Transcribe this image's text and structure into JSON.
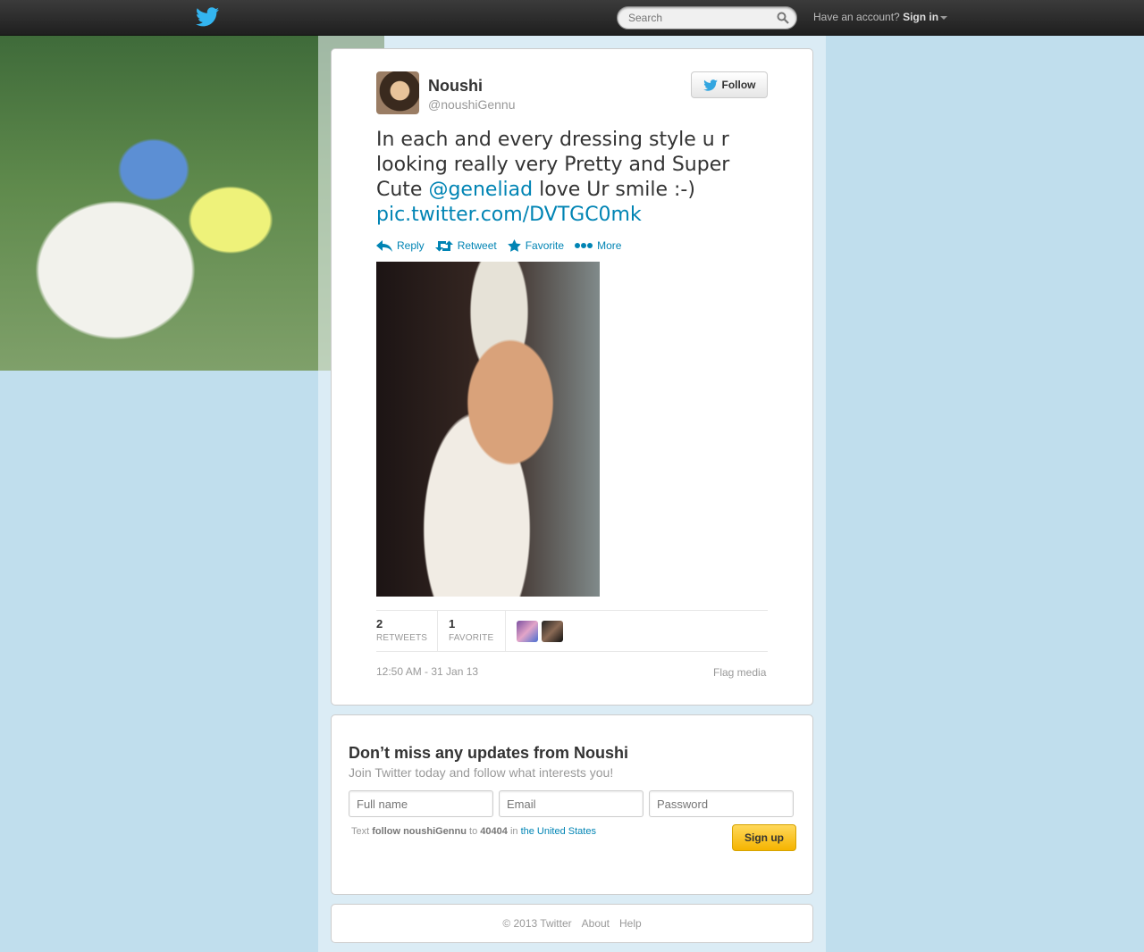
{
  "topbar": {
    "search_placeholder": "Search",
    "have_account": "Have an account?",
    "sign_in": "Sign in"
  },
  "tweet": {
    "name": "Noushi",
    "handle": "@noushiGennu",
    "follow_label": "Follow",
    "text_part1": "In each and every dressing style u r looking really very Pretty and Super Cute ",
    "mention": "@geneliad",
    "text_part2": " love Ur smile :-) ",
    "link": "pic.twitter.com/DVTGC0mk",
    "actions": {
      "reply": "Reply",
      "retweet": "Retweet",
      "favorite": "Favorite",
      "more": "More"
    },
    "stats": {
      "retweets_count": "2",
      "retweets_label": "RETWEETS",
      "favorites_count": "1",
      "favorites_label": "FAVORITE"
    },
    "timestamp": "12:50 AM - 31 Jan 13",
    "flag_media": "Flag media"
  },
  "signup": {
    "title": "Don’t miss any updates from Noushi",
    "subtitle": "Join Twitter today and follow what interests you!",
    "full_name_placeholder": "Full name",
    "email_placeholder": "Email",
    "password_placeholder": "Password",
    "sms_text": "Text",
    "sms_command": "follow noushiGennu",
    "sms_to": "to",
    "sms_number": "40404",
    "sms_in": "in",
    "sms_country": "the United States",
    "button": "Sign up"
  },
  "footer": {
    "copyright": "© 2013 Twitter",
    "about": "About",
    "help": "Help"
  },
  "colors": {
    "background": "#C0DEED",
    "link": "#0084B4",
    "brand": "#55ACEE",
    "signup_button": "#F5B400"
  },
  "icons": [
    "twitter-bird-icon",
    "search-icon",
    "reply-icon",
    "retweet-icon",
    "star-icon",
    "more-icon"
  ]
}
